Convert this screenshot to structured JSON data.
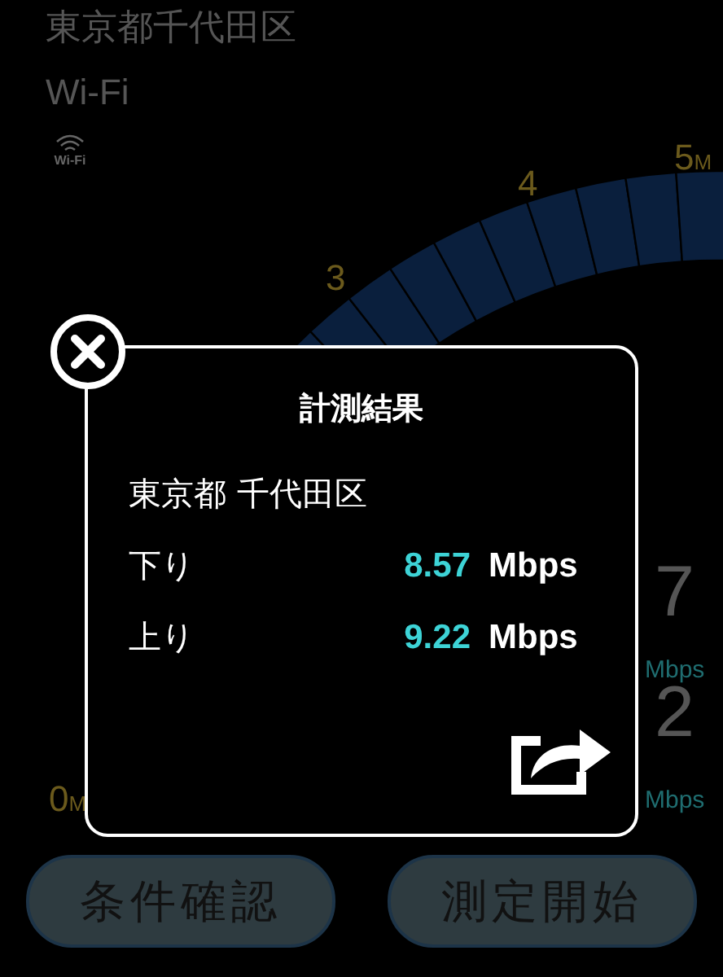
{
  "header": {
    "location": "東京都千代田区",
    "network": "Wi-Fi",
    "network_icon_label": "Wi-Fi"
  },
  "gauge": {
    "scale_labels": [
      {
        "value": "3"
      },
      {
        "value": "4"
      },
      {
        "value": "5",
        "unit": "M"
      },
      {
        "value": "0",
        "unit": "M"
      }
    ],
    "readings": [
      {
        "value": "7",
        "unit": "Mbps"
      },
      {
        "value": "2",
        "unit": "Mbps"
      }
    ]
  },
  "dialog": {
    "title": "計測結果",
    "location": "東京都 千代田区",
    "rows": [
      {
        "label": "下り",
        "value": "8.57",
        "unit": "Mbps"
      },
      {
        "label": "上り",
        "value": "9.22",
        "unit": "Mbps"
      }
    ]
  },
  "buttons": [
    "条件確認",
    "測定開始"
  ]
}
